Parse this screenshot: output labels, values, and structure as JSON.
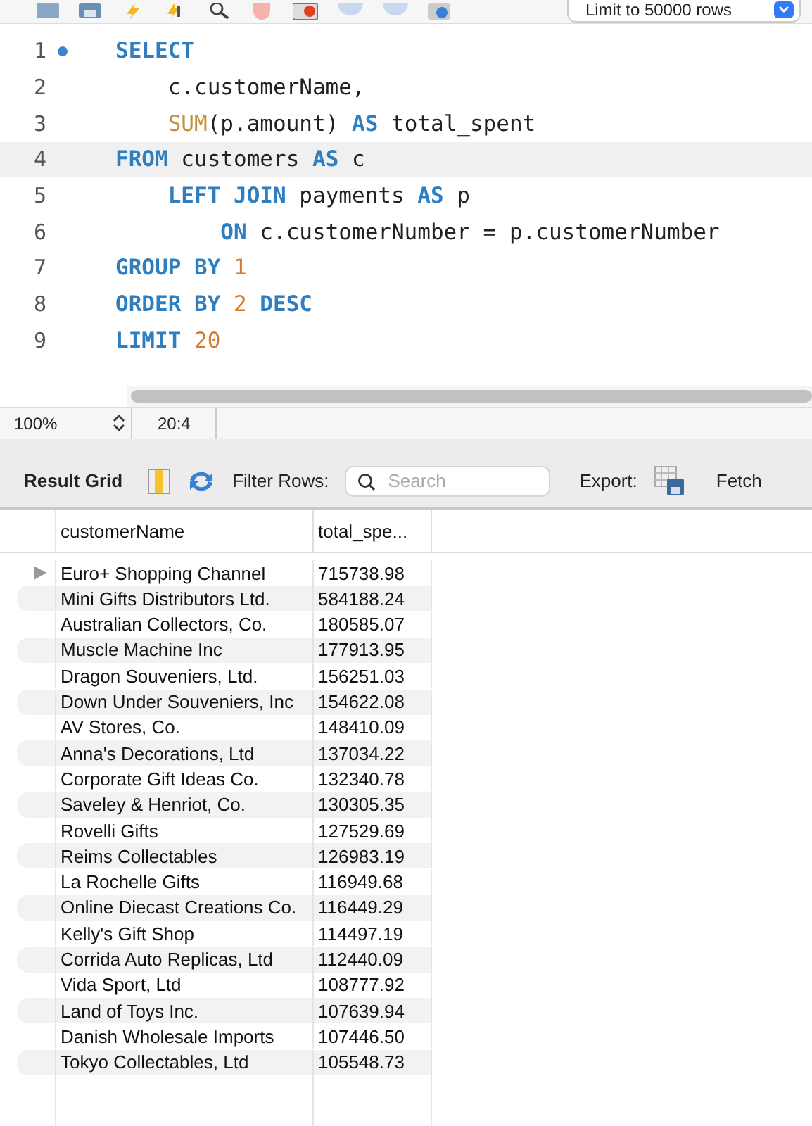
{
  "toolbar": {
    "limit_select": "Limit to 50000 rows"
  },
  "editor": {
    "lines": [
      {
        "number": "1",
        "marker": true,
        "current": false,
        "tokens": [
          {
            "kind": "keyword",
            "text": "SELECT"
          }
        ]
      },
      {
        "number": "2",
        "marker": false,
        "current": false,
        "tokens": [
          {
            "kind": "plain",
            "text": "    c.customerName,"
          }
        ]
      },
      {
        "number": "3",
        "marker": false,
        "current": false,
        "tokens": [
          {
            "kind": "function",
            "text": "    SUM"
          },
          {
            "kind": "plain",
            "text": "(p.amount) "
          },
          {
            "kind": "keyword",
            "text": "AS"
          },
          {
            "kind": "plain",
            "text": " total_spent"
          }
        ]
      },
      {
        "number": "4",
        "marker": false,
        "current": true,
        "tokens": [
          {
            "kind": "keyword",
            "text": "FROM"
          },
          {
            "kind": "plain",
            "text": " customers "
          },
          {
            "kind": "keyword",
            "text": "AS"
          },
          {
            "kind": "plain",
            "text": " c"
          }
        ]
      },
      {
        "number": "5",
        "marker": false,
        "current": false,
        "tokens": [
          {
            "kind": "keyword",
            "text": "    LEFT JOIN"
          },
          {
            "kind": "plain",
            "text": " payments "
          },
          {
            "kind": "keyword",
            "text": "AS"
          },
          {
            "kind": "plain",
            "text": " p"
          }
        ]
      },
      {
        "number": "6",
        "marker": false,
        "current": false,
        "tokens": [
          {
            "kind": "keyword",
            "text": "        ON"
          },
          {
            "kind": "plain",
            "text": " c.customerNumber = p.customerNumber"
          }
        ]
      },
      {
        "number": "7",
        "marker": false,
        "current": false,
        "tokens": [
          {
            "kind": "keyword",
            "text": "GROUP BY"
          },
          {
            "kind": "number",
            "text": " 1"
          }
        ]
      },
      {
        "number": "8",
        "marker": false,
        "current": false,
        "tokens": [
          {
            "kind": "keyword",
            "text": "ORDER BY"
          },
          {
            "kind": "number",
            "text": " 2"
          },
          {
            "kind": "keyword",
            "text": " DESC"
          }
        ]
      },
      {
        "number": "9",
        "marker": false,
        "current": false,
        "tokens": [
          {
            "kind": "keyword",
            "text": "LIMIT"
          },
          {
            "kind": "number",
            "text": " 20"
          }
        ]
      }
    ]
  },
  "status_bar": {
    "zoom": "100%",
    "position": "20:4"
  },
  "result_toolbar": {
    "title": "Result Grid",
    "filter_label": "Filter Rows:",
    "search_placeholder": "Search",
    "export_label": "Export:",
    "fetch_label": "Fetch"
  },
  "table": {
    "columns": [
      "customerName",
      "total_spe..."
    ],
    "rows": [
      {
        "cells": [
          "Euro+ Shopping Channel",
          "715738.98"
        ],
        "selected": true
      },
      {
        "cells": [
          "Mini Gifts Distributors Ltd.",
          "584188.24"
        ],
        "selected": false
      },
      {
        "cells": [
          "Australian Collectors, Co.",
          "180585.07"
        ],
        "selected": false
      },
      {
        "cells": [
          "Muscle Machine Inc",
          "177913.95"
        ],
        "selected": false
      },
      {
        "cells": [
          "Dragon Souveniers, Ltd.",
          "156251.03"
        ],
        "selected": false
      },
      {
        "cells": [
          "Down Under Souveniers, Inc",
          "154622.08"
        ],
        "selected": false
      },
      {
        "cells": [
          "AV Stores, Co.",
          "148410.09"
        ],
        "selected": false
      },
      {
        "cells": [
          "Anna's Decorations, Ltd",
          "137034.22"
        ],
        "selected": false
      },
      {
        "cells": [
          "Corporate Gift Ideas Co.",
          "132340.78"
        ],
        "selected": false
      },
      {
        "cells": [
          "Saveley & Henriot, Co.",
          "130305.35"
        ],
        "selected": false
      },
      {
        "cells": [
          "Rovelli Gifts",
          "127529.69"
        ],
        "selected": false
      },
      {
        "cells": [
          "Reims Collectables",
          "126983.19"
        ],
        "selected": false
      },
      {
        "cells": [
          "La Rochelle Gifts",
          "116949.68"
        ],
        "selected": false
      },
      {
        "cells": [
          "Online Diecast Creations Co.",
          "116449.29"
        ],
        "selected": false
      },
      {
        "cells": [
          "Kelly's Gift Shop",
          "114497.19"
        ],
        "selected": false
      },
      {
        "cells": [
          "Corrida Auto Replicas, Ltd",
          "112440.09"
        ],
        "selected": false
      },
      {
        "cells": [
          "Vida Sport, Ltd",
          "108777.92"
        ],
        "selected": false
      },
      {
        "cells": [
          "Land of Toys Inc.",
          "107639.94"
        ],
        "selected": false
      },
      {
        "cells": [
          "Danish Wholesale Imports",
          "107446.50"
        ],
        "selected": false
      },
      {
        "cells": [
          "Tokyo Collectables, Ltd",
          "105548.73"
        ],
        "selected": false
      }
    ]
  }
}
